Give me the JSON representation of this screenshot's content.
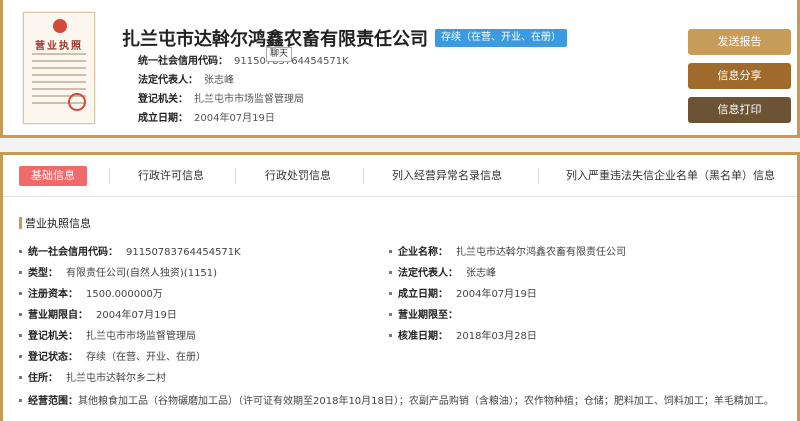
{
  "header": {
    "license_image_title": "营业执照",
    "company_name": "扎兰屯市达斡尔鸿鑫农畜有限责任公司",
    "status_badge": "存续（在营、开业、在册）",
    "tooltip": "聊天",
    "rows": [
      {
        "label": "统一社会信用代码：",
        "value": "91150783764454571K"
      },
      {
        "label": "法定代表人：",
        "value": "张志峰"
      },
      {
        "label": "登记机关：",
        "value": "扎兰屯市市场监督管理局"
      },
      {
        "label": "成立日期：",
        "value": "2004年07月19日"
      }
    ],
    "buttons": {
      "send_report": "发送报告",
      "share_info": "信息分享",
      "print_info": "信息打印"
    }
  },
  "tabs": [
    {
      "label": "基础信息",
      "active": true
    },
    {
      "label": "行政许可信息"
    },
    {
      "label": "行政处罚信息"
    },
    {
      "label": "列入经营异常名录信息"
    },
    {
      "label": "列入严重违法失信企业名单（黑名单）信息"
    }
  ],
  "section": {
    "title": "营业执照信息",
    "left": [
      {
        "label": "统一社会信用代码：",
        "value": "91150783764454571K"
      },
      {
        "label": "类型：",
        "value": "有限责任公司(自然人独资)(1151)"
      },
      {
        "label": "注册资本：",
        "value": "1500.000000万"
      },
      {
        "label": "营业期限自：",
        "value": "2004年07月19日"
      },
      {
        "label": "登记机关：",
        "value": "扎兰屯市市场监督管理局"
      },
      {
        "label": "登记状态：",
        "value": "存续（在营、开业、在册）"
      },
      {
        "label": "住所：",
        "value": "扎兰屯市达斡尔乡二村"
      }
    ],
    "right": [
      {
        "label": "企业名称：",
        "value": "扎兰屯市达斡尔鸿鑫农畜有限责任公司"
      },
      {
        "label": "法定代表人：",
        "value": "张志峰"
      },
      {
        "label": "成立日期：",
        "value": "2004年07月19日"
      },
      {
        "label": "营业期限至：",
        "value": ""
      },
      {
        "label": "核准日期：",
        "value": "2018年03月28日"
      }
    ],
    "scope": {
      "label": "经营范围：",
      "value": "其他粮食加工品（谷物碾磨加工品）（许可证有效期至2018年10月18日）；农副产品购销（含粮油）；农作物种植；仓储；肥料加工、饲料加工；羊毛精加工。"
    }
  }
}
